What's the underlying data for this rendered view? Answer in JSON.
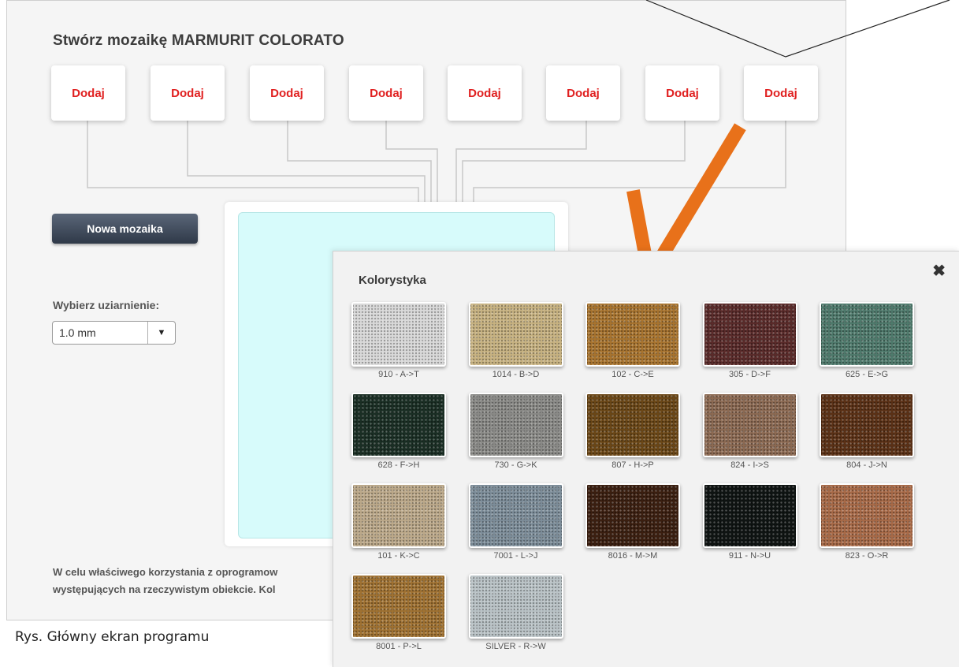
{
  "app": {
    "title": "Stwórz mozaikę MARMURIT COLORATO",
    "slots": [
      "Dodaj",
      "Dodaj",
      "Dodaj",
      "Dodaj",
      "Dodaj",
      "Dodaj",
      "Dodaj",
      "Dodaj"
    ],
    "new_button": "Nowa mozaika",
    "grain_label": "Wybierz uziarnienie:",
    "grain_value": "1.0 mm",
    "info_line1": "W celu właściwego korzystania z oprogramow",
    "info_line2": "występujących na rzeczywistym obiekcie. Kol"
  },
  "caption": "Rys. Główny ekran programu",
  "overlay": {
    "arrow_color": "#e8711a"
  },
  "popup": {
    "title": "Kolorystyka",
    "close_icon": "close-icon",
    "swatches": [
      {
        "label": "910 - A->T",
        "color": "#d9d9d9"
      },
      {
        "label": "1014 - B->D",
        "color": "#c7b281"
      },
      {
        "label": "102 - C->E",
        "color": "#a8742f"
      },
      {
        "label": "305 - D->F",
        "color": "#5a2b2a"
      },
      {
        "label": "625 - E->G",
        "color": "#4f7a6c"
      },
      {
        "label": "628 - F->H",
        "color": "#1b2f25"
      },
      {
        "label": "730 - G->K",
        "color": "#8a8a87"
      },
      {
        "label": "807 - H->P",
        "color": "#6b4717"
      },
      {
        "label": "824 - I->S",
        "color": "#8c6a53"
      },
      {
        "label": "804 - J->N",
        "color": "#5b3116"
      },
      {
        "label": "101 - K->C",
        "color": "#bca98a"
      },
      {
        "label": "7001 - L->J",
        "color": "#7d8d99"
      },
      {
        "label": "8016 - M->M",
        "color": "#3b1f10"
      },
      {
        "label": "911 - N->U",
        "color": "#0f1413"
      },
      {
        "label": "823 - O->R",
        "color": "#a86a48"
      },
      {
        "label": "8001 - P->L",
        "color": "#a07232"
      },
      {
        "label": "SILVER - R->W",
        "color": "#b9c2c6"
      }
    ]
  }
}
